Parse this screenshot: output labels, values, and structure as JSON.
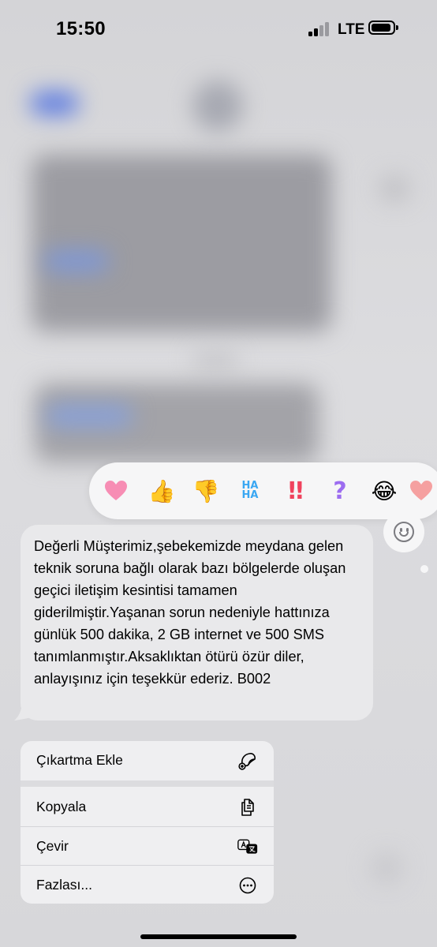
{
  "status_bar": {
    "time": "15:50",
    "network": "LTE"
  },
  "reactions": [
    {
      "name": "heart",
      "glyph": "🩷"
    },
    {
      "name": "thumbs-up",
      "glyph": "👍"
    },
    {
      "name": "thumbs-down",
      "glyph": "👎"
    },
    {
      "name": "haha",
      "glyph": "HA HA"
    },
    {
      "name": "exclamation",
      "glyph": "‼"
    },
    {
      "name": "question",
      "glyph": "?"
    },
    {
      "name": "laugh",
      "glyph": "😂"
    }
  ],
  "message": {
    "text": "Değerli Müşterimiz,şebekemizde meydana gelen teknik soruna bağlı olarak bazı bölgelerde oluşan geçici iletişim kesintisi tamamen giderilmiştir.Yaşanan sorun nedeniyle hattınıza günlük 500 dakika, 2 GB internet ve 500 SMS tanımlanmıştır.Aksaklıktan ötürü özür diler, anlayışınız için teşekkür ederiz. B002"
  },
  "menu": {
    "add_sticker": "Çıkartma Ekle",
    "copy": "Kopyala",
    "translate": "Çevir",
    "more": "Fazlası..."
  },
  "icons": {
    "sticker": "sticker-add-icon",
    "copy": "copy-icon",
    "translate": "translate-icon",
    "more": "ellipsis-circle-icon",
    "smiley": "smiley-icon"
  }
}
